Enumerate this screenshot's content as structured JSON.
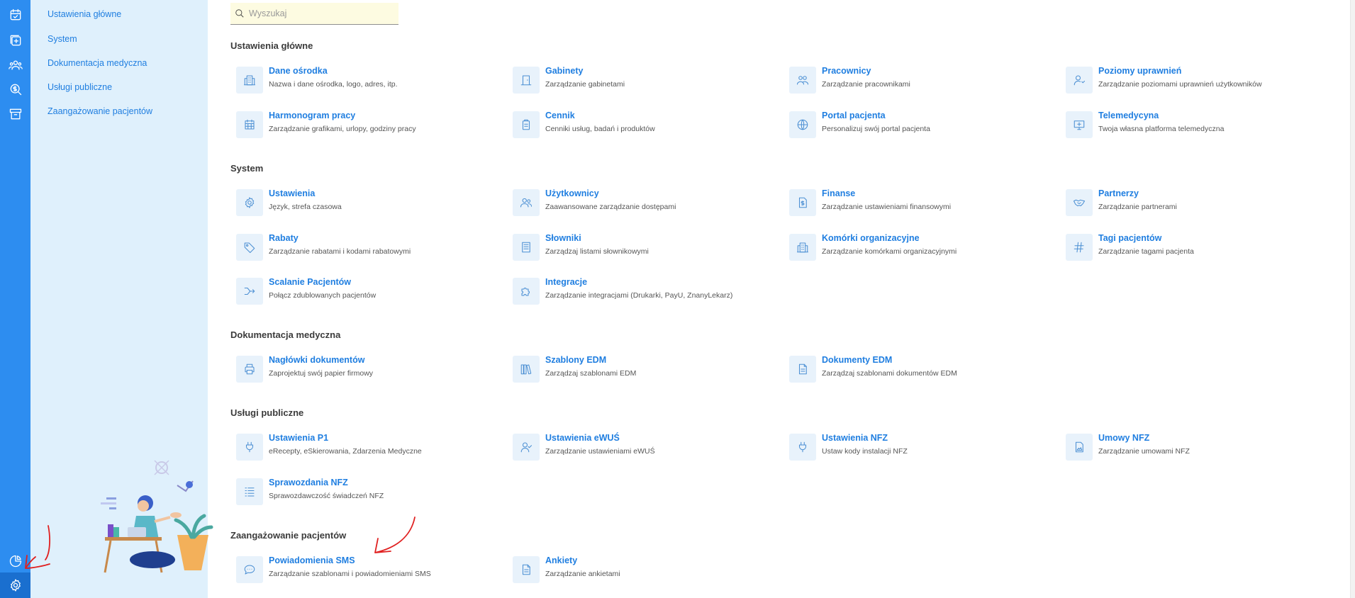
{
  "search": {
    "placeholder": "Wyszukaj",
    "value": ""
  },
  "subnav": {
    "items": [
      {
        "label": "Ustawienia główne"
      },
      {
        "label": "System"
      },
      {
        "label": "Dokumentacja medyczna"
      },
      {
        "label": "Usługi publiczne"
      },
      {
        "label": "Zaangażowanie pacjentów"
      }
    ]
  },
  "rail": {
    "items": [
      {
        "icon": "calendar-check-icon"
      },
      {
        "icon": "medical-folder-icon"
      },
      {
        "icon": "users-icon"
      },
      {
        "icon": "money-search-icon"
      },
      {
        "icon": "archive-icon"
      },
      {
        "icon": "pie-chart-icon"
      },
      {
        "icon": "gear-icon",
        "active": true
      }
    ],
    "accent": "#2d8df0"
  },
  "sections": [
    {
      "title": "Ustawienia główne",
      "tiles": [
        {
          "title": "Dane ośrodka",
          "desc": "Nazwa i dane ośrodka, logo, adres, itp.",
          "icon": "building-icon"
        },
        {
          "title": "Gabinety",
          "desc": "Zarządzanie gabinetami",
          "icon": "door-icon"
        },
        {
          "title": "Pracownicy",
          "desc": "Zarządzanie pracownikami",
          "icon": "staff-icon"
        },
        {
          "title": "Poziomy uprawnień",
          "desc": "Zarządzanie poziomami uprawnień użytkowników",
          "icon": "user-permission-icon"
        },
        {
          "title": "Harmonogram pracy",
          "desc": "Zarządzanie grafikami, urlopy, godziny pracy",
          "icon": "calendar-grid-icon"
        },
        {
          "title": "Cennik",
          "desc": "Cenniki usług, badań i produktów",
          "icon": "clipboard-icon"
        },
        {
          "title": "Portal pacjenta",
          "desc": "Personalizuj swój portal pacjenta",
          "icon": "globe-icon"
        },
        {
          "title": "Telemedycyna",
          "desc": "Twoja własna platforma telemedyczna",
          "icon": "monitor-plus-icon"
        }
      ]
    },
    {
      "title": "System",
      "tiles": [
        {
          "title": "Ustawienia",
          "desc": "Język, strefa czasowa",
          "icon": "gear-icon"
        },
        {
          "title": "Użytkownicy",
          "desc": "Zaawansowane zarządzanie dostępami",
          "icon": "users-icon"
        },
        {
          "title": "Finanse",
          "desc": "Zarządzanie ustawieniami finansowymi",
          "icon": "money-document-icon"
        },
        {
          "title": "Partnerzy",
          "desc": "Zarządzanie partnerami",
          "icon": "handshake-icon"
        },
        {
          "title": "Rabaty",
          "desc": "Zarządzanie rabatami i kodami rabatowymi",
          "icon": "tag-icon"
        },
        {
          "title": "Słowniki",
          "desc": "Zarządzaj listami słownikowymi",
          "icon": "book-icon"
        },
        {
          "title": "Komórki organizacyjne",
          "desc": "Zarządzanie komórkami organizacyjnymi",
          "icon": "building-icon"
        },
        {
          "title": "Tagi pacjentów",
          "desc": "Zarządzanie tagami pacjenta",
          "icon": "hash-icon"
        },
        {
          "title": "Scalanie Pacjentów",
          "desc": "Połącz zdublowanych pacjentów",
          "icon": "merge-icon"
        },
        {
          "title": "Integracje",
          "desc": "Zarządzanie integracjami (Drukarki, PayU, ZnanyLekarz)",
          "icon": "puzzle-icon"
        }
      ]
    },
    {
      "title": "Dokumentacja medyczna",
      "tiles": [
        {
          "title": "Nagłówki dokumentów",
          "desc": "Zaprojektuj swój papier firmowy",
          "icon": "printer-icon"
        },
        {
          "title": "Szablony EDM",
          "desc": "Zarządzaj szablonami EDM",
          "icon": "books-icon"
        },
        {
          "title": "Dokumenty EDM",
          "desc": "Zarządzaj szablonami dokumentów EDM",
          "icon": "document-icon"
        }
      ]
    },
    {
      "title": "Usługi publiczne",
      "tiles": [
        {
          "title": "Ustawienia P1",
          "desc": "eRecepty, eSkierowania, Zdarzenia Medyczne",
          "icon": "plug-icon"
        },
        {
          "title": "Ustawienia eWUŚ",
          "desc": "Zarządzanie ustawieniami eWUŚ",
          "icon": "user-check-icon"
        },
        {
          "title": "Ustawienia NFZ",
          "desc": "Ustaw kody instalacji NFZ",
          "icon": "plug-icon"
        },
        {
          "title": "Umowy NFZ",
          "desc": "Zarządzanie umowami NFZ",
          "icon": "image-document-icon"
        },
        {
          "title": "Sprawozdania NFZ",
          "desc": "Sprawozdawczość świadczeń NFZ",
          "icon": "list-icon"
        }
      ]
    },
    {
      "title": "Zaangażowanie pacjentów",
      "tiles": [
        {
          "title": "Powiadomienia SMS",
          "desc": "Zarządzanie szablonami i powiadomieniami SMS",
          "icon": "sms-icon"
        },
        {
          "title": "Ankiety",
          "desc": "Zarządzanie ankietami",
          "icon": "document-icon"
        }
      ]
    }
  ],
  "colors": {
    "link": "#1f7ee0",
    "subnav_bg": "#dff0fc",
    "search_bg": "#fdfbe1",
    "annotation": "#e02020"
  }
}
